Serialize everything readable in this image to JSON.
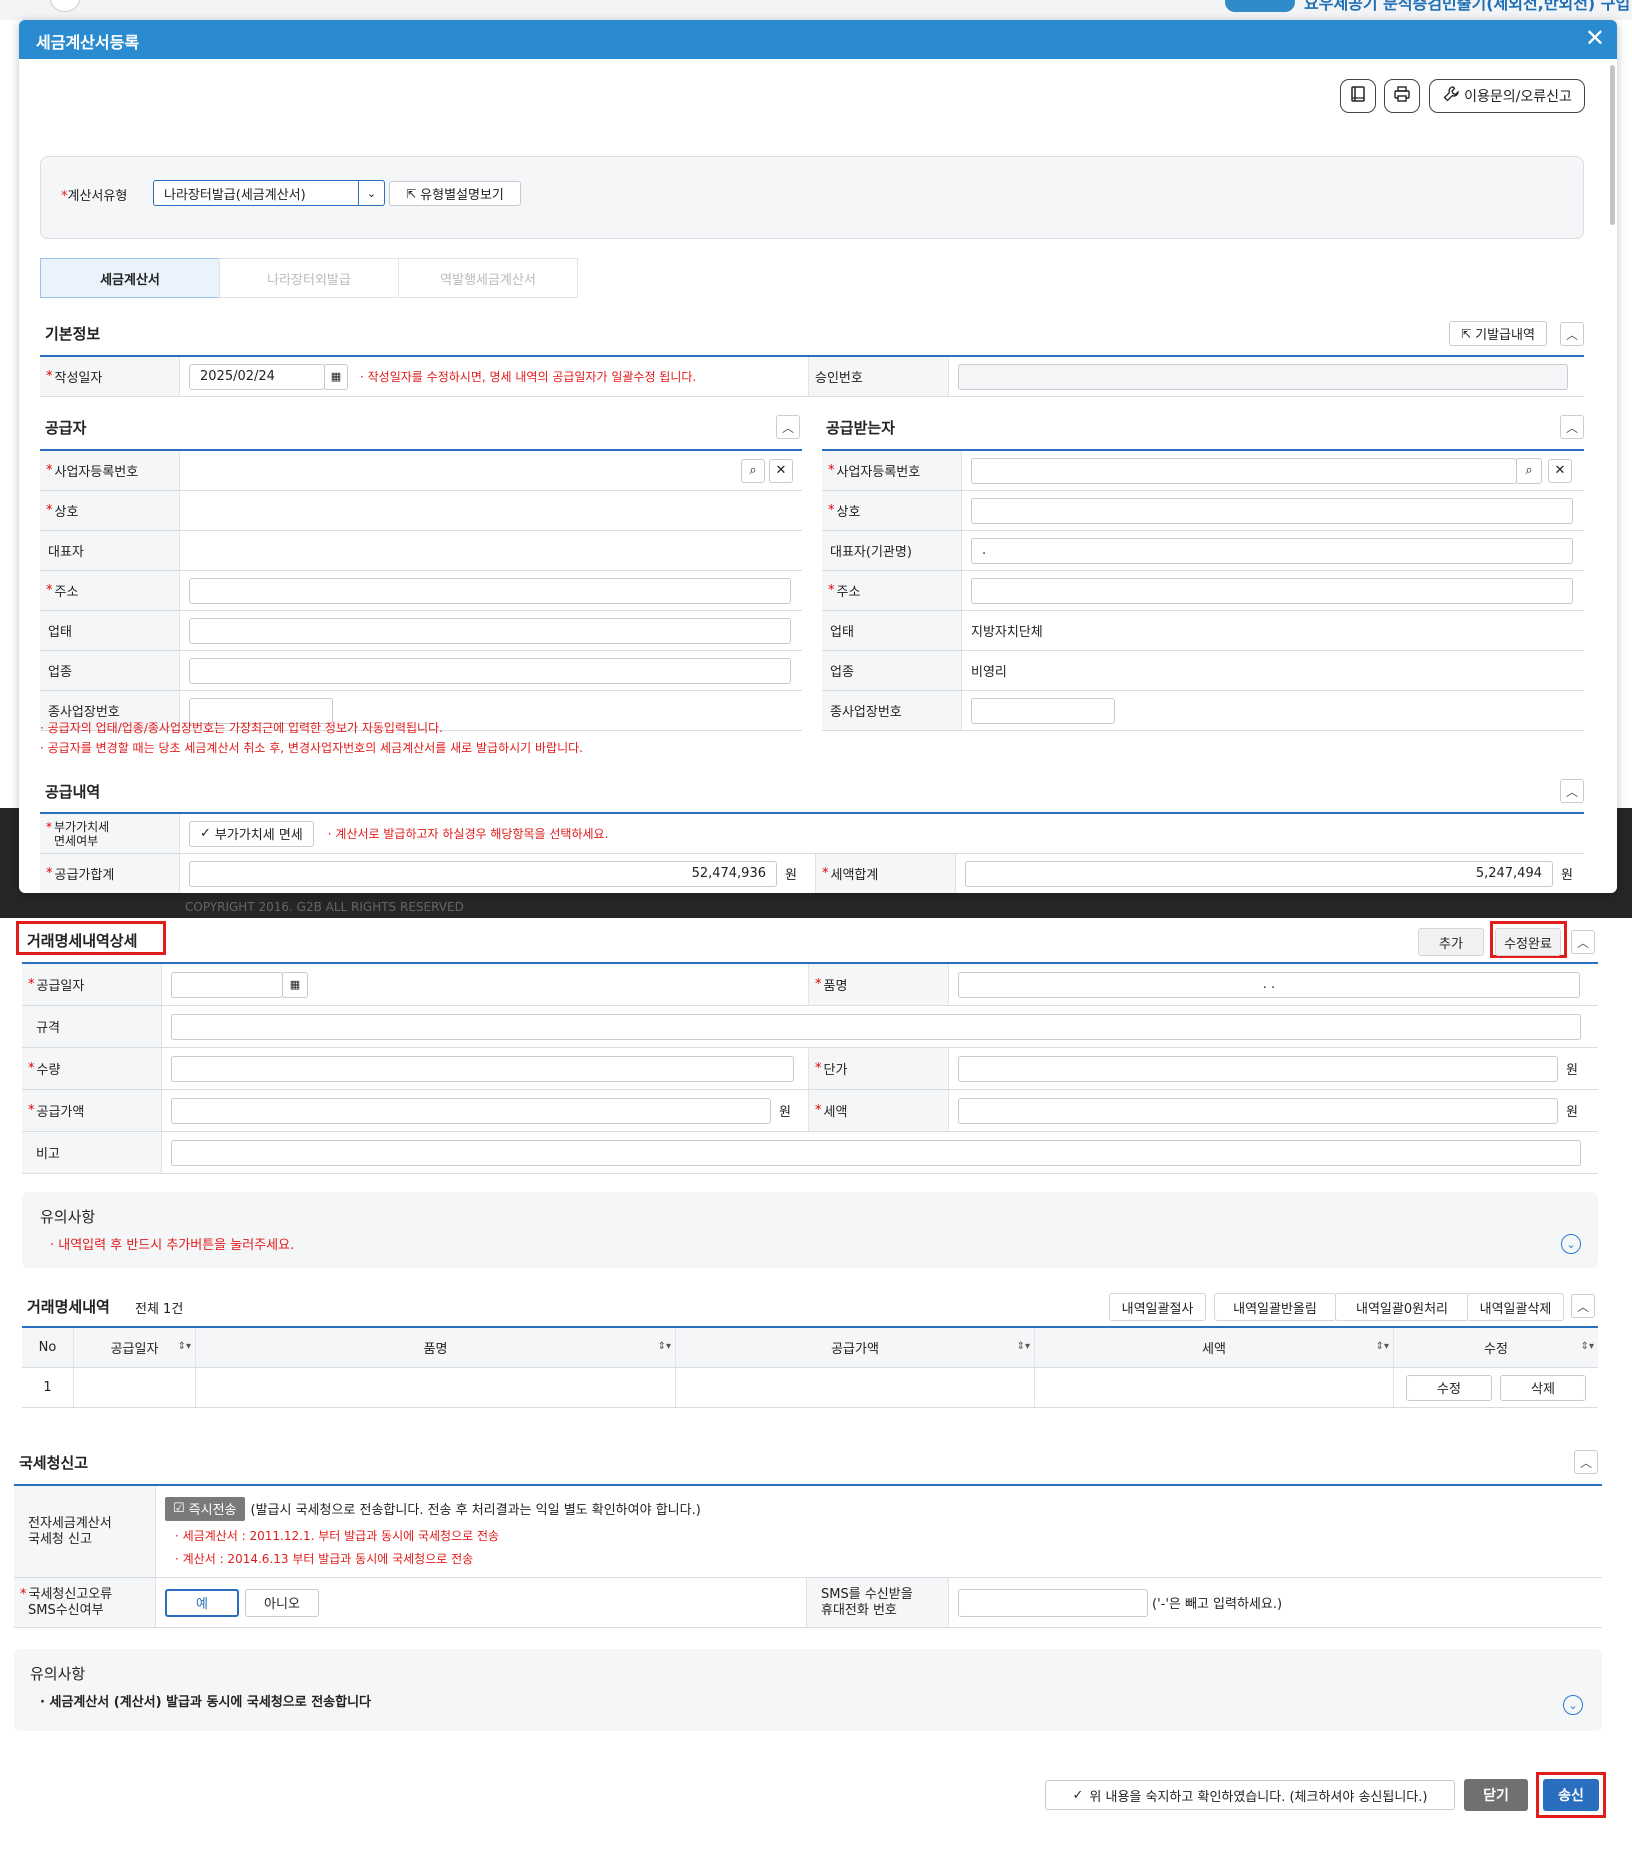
{
  "background": {
    "headline": "요우세공기 분석증검민출기(제외전,반외전) 구입",
    "copyright": "COPYRIGHT 2016. G2B ALL RIGHTS RESERVED"
  },
  "modal": {
    "title": "세금계산서등록",
    "toolbar": {
      "help_label": "이용문의/오류신고"
    },
    "type": {
      "label": "계산서유형",
      "selected": "나라장터발급(세금계산서)",
      "view_button": "유형별설명보기"
    },
    "tabs": [
      "세금계산서",
      "나라장터외발급",
      "역발행세금계산서"
    ],
    "basic": {
      "title": "기본정보",
      "history_button": "기발급내역",
      "date_label": "작성일자",
      "date_value": "2025/02/24",
      "date_note": "작성일자를 수정하시면, 명세 내역의 공급일자가 일괄수정 됩니다.",
      "approval_label": "승인번호"
    },
    "supplier": {
      "title": "공급자",
      "rows": [
        {
          "label": "사업자등록번호",
          "req": "*"
        },
        {
          "label": "상호",
          "req": "*"
        },
        {
          "label": "대표자",
          "req": ""
        },
        {
          "label": "주소",
          "req": "*"
        },
        {
          "label": "업태",
          "req": ""
        },
        {
          "label": "업종",
          "req": ""
        },
        {
          "label": "종사업장번호",
          "req": ""
        }
      ]
    },
    "receiver": {
      "title": "공급받는자",
      "rows": [
        {
          "label": "사업자등록번호",
          "req": "*"
        },
        {
          "label": "상호",
          "req": "*"
        },
        {
          "label": "대표자(기관명)",
          "req": ""
        },
        {
          "label": "주소",
          "req": "*"
        },
        {
          "label": "업태",
          "req": ""
        },
        {
          "label": "업종",
          "req": ""
        },
        {
          "label": "종사업장번호",
          "req": ""
        }
      ],
      "rep_value": ".",
      "business_type": "지방자치단체",
      "business_item": "비영리"
    },
    "notes": [
      "공급자의 업태/업종/종사업장번호는 가장최근에 입력한 정보가 자동입력됩니다.",
      "공급자를 변경할 때는 당초 세금계산서 취소 후, 변경사업자번호의 세금계산서를 새로 발급하시기 바랍니다."
    ],
    "supply": {
      "title": "공급내역",
      "vat_label_1": "부가가치세",
      "vat_label_2": "면세여부",
      "vat_checkbox": "부가가치세 면세",
      "vat_note": "계산서로 발급하고자 하실경우 해당항목을 선택하세요.",
      "total_label": "공급가합계",
      "total_value": "52,474,936",
      "tax_total_label": "세액합계",
      "tax_total_value": "5,247,494",
      "won": "원"
    }
  },
  "detail": {
    "title": "거래명세내역상세",
    "add_button": "추가",
    "done_button": "수정완료",
    "labels": {
      "date": "공급일자",
      "item": "품명",
      "spec": "규격",
      "qty": "수량",
      "price": "단가",
      "amount": "공급가액",
      "tax": "세액",
      "remark": "비고"
    },
    "item_value": ".          .",
    "won": "원"
  },
  "caution1": {
    "title": "유의사항",
    "text": "내역입력 후 반드시 추가버튼을 눌러주세요."
  },
  "list": {
    "title": "거래명세내역",
    "count": "전체 1건",
    "buttons": [
      "내역일괄절사",
      "내역일괄반올림",
      "내역일괄0원처리",
      "내역일괄삭제"
    ],
    "columns": [
      "No",
      "공급일자",
      "품명",
      "공급가액",
      "세액",
      "수정"
    ],
    "rows": [
      {
        "no": "1",
        "edit": "수정",
        "delete": "삭제"
      }
    ]
  },
  "nts": {
    "title": "국세청신고",
    "label_1": "전자세금계산서",
    "label_2": "국세청 신고",
    "instant_button": "즉시전송",
    "instant_desc": "(발급시 국세청으로 전송합니다. 전송 후 처리결과는 익일 별도 확인하여야 합니다.)",
    "note1": "세금계산서 : 2011.12.1. 부터 발급과 동시에 국세청으로 전송",
    "note2": "계산서 : 2014.6.13 부터 발급과 동시에 국세청으로 전송",
    "sms_label_1": "국세청신고오류",
    "sms_label_2": "SMS수신여부",
    "yes": "예",
    "no": "아니오",
    "phone_label_1": "SMS를 수신받을",
    "phone_label_2": "휴대전화 번호",
    "phone_note": "('-'은 빼고 입력하세요.)"
  },
  "caution2": {
    "title": "유의사항",
    "text": "세금계산서 (계산서) 발급과 동시에 국세청으로 전송합니다"
  },
  "footer": {
    "confirm": "위 내용을 숙지하고 확인하였습니다. (체크하셔야 송신됩니다.)",
    "close": "닫기",
    "send": "송신"
  },
  "colors": {
    "header_blue": "#2a8bd1",
    "rule_blue": "#2a6ec0",
    "required_red": "#e21b1b",
    "highlight_box": "#e21b1b"
  }
}
